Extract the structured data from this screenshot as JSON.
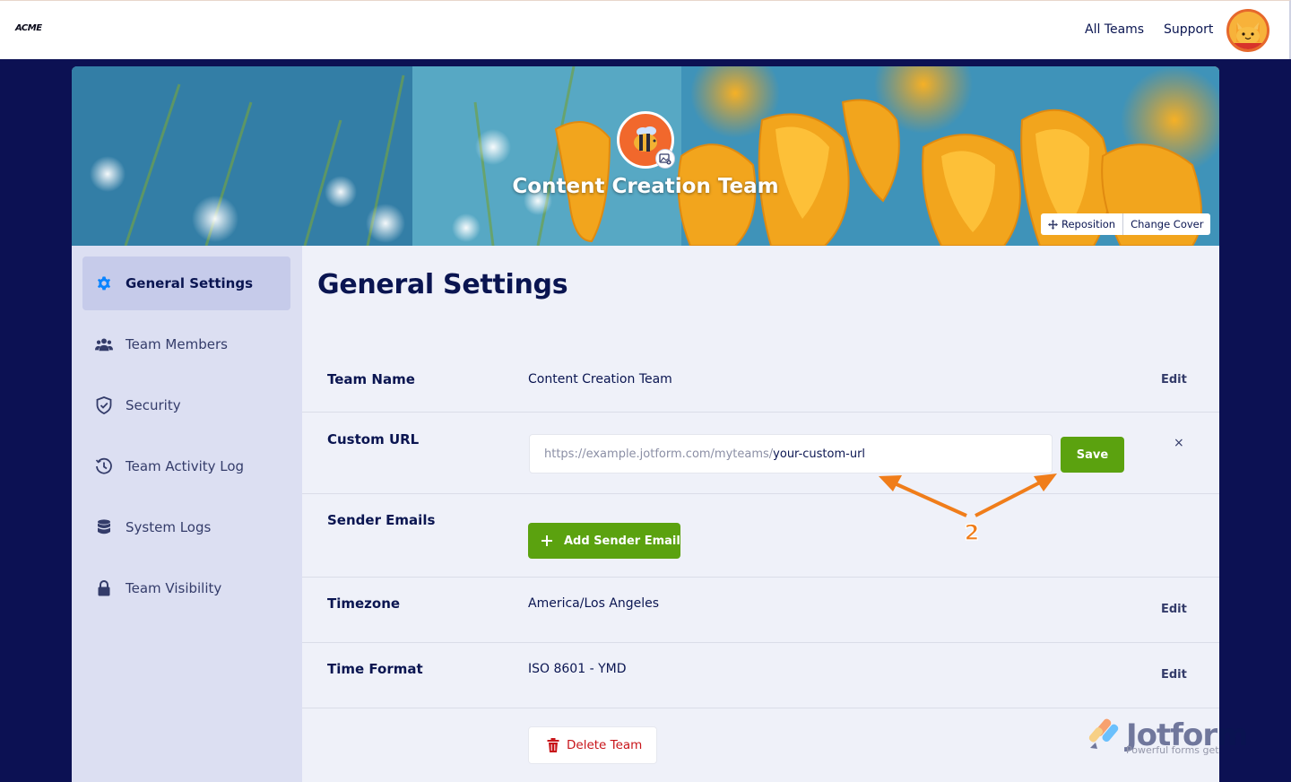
{
  "header": {
    "logo": "ACME",
    "nav": [
      "All Teams",
      "Support"
    ]
  },
  "cover": {
    "team_name": "Content Creation Team",
    "reposition_label": "Reposition",
    "change_cover_label": "Change Cover"
  },
  "sidebar": {
    "items": [
      {
        "label": "General Settings",
        "icon": "gear-icon",
        "active": true
      },
      {
        "label": "Team Members",
        "icon": "users-icon",
        "active": false
      },
      {
        "label": "Security",
        "icon": "shield-icon",
        "active": false
      },
      {
        "label": "Team Activity Log",
        "icon": "clock-history-icon",
        "active": false
      },
      {
        "label": "System Logs",
        "icon": "database-icon",
        "active": false
      },
      {
        "label": "Team Visibility",
        "icon": "lock-icon",
        "active": false
      }
    ]
  },
  "main": {
    "title": "General Settings",
    "team_name": {
      "label": "Team Name",
      "value": "Content Creation Team",
      "edit": "Edit"
    },
    "custom_url": {
      "label": "Custom URL",
      "prefix": "https://example.jotform.com/myteams/",
      "value": "your-custom-url",
      "save": "Save",
      "close": "×"
    },
    "sender_emails": {
      "label": "Sender Emails",
      "button": "Add Sender Email"
    },
    "timezone": {
      "label": "Timezone",
      "value": "America/Los Angeles",
      "edit": "Edit"
    },
    "time_format": {
      "label": "Time Format",
      "value": "ISO 8601 - YMD",
      "edit": "Edit"
    },
    "delete": {
      "label": "Delete Team"
    }
  },
  "annotation": {
    "number": "2",
    "color": "#f07d1a"
  },
  "watermark": {
    "brand": "Jotform",
    "tagline": "Powerful forms get"
  },
  "colors": {
    "navy": "#0a1551",
    "green": "#5ba20f",
    "danger": "#c8151a",
    "sidebar_bg": "#dcdff2",
    "active_bg": "#c6cbea"
  }
}
